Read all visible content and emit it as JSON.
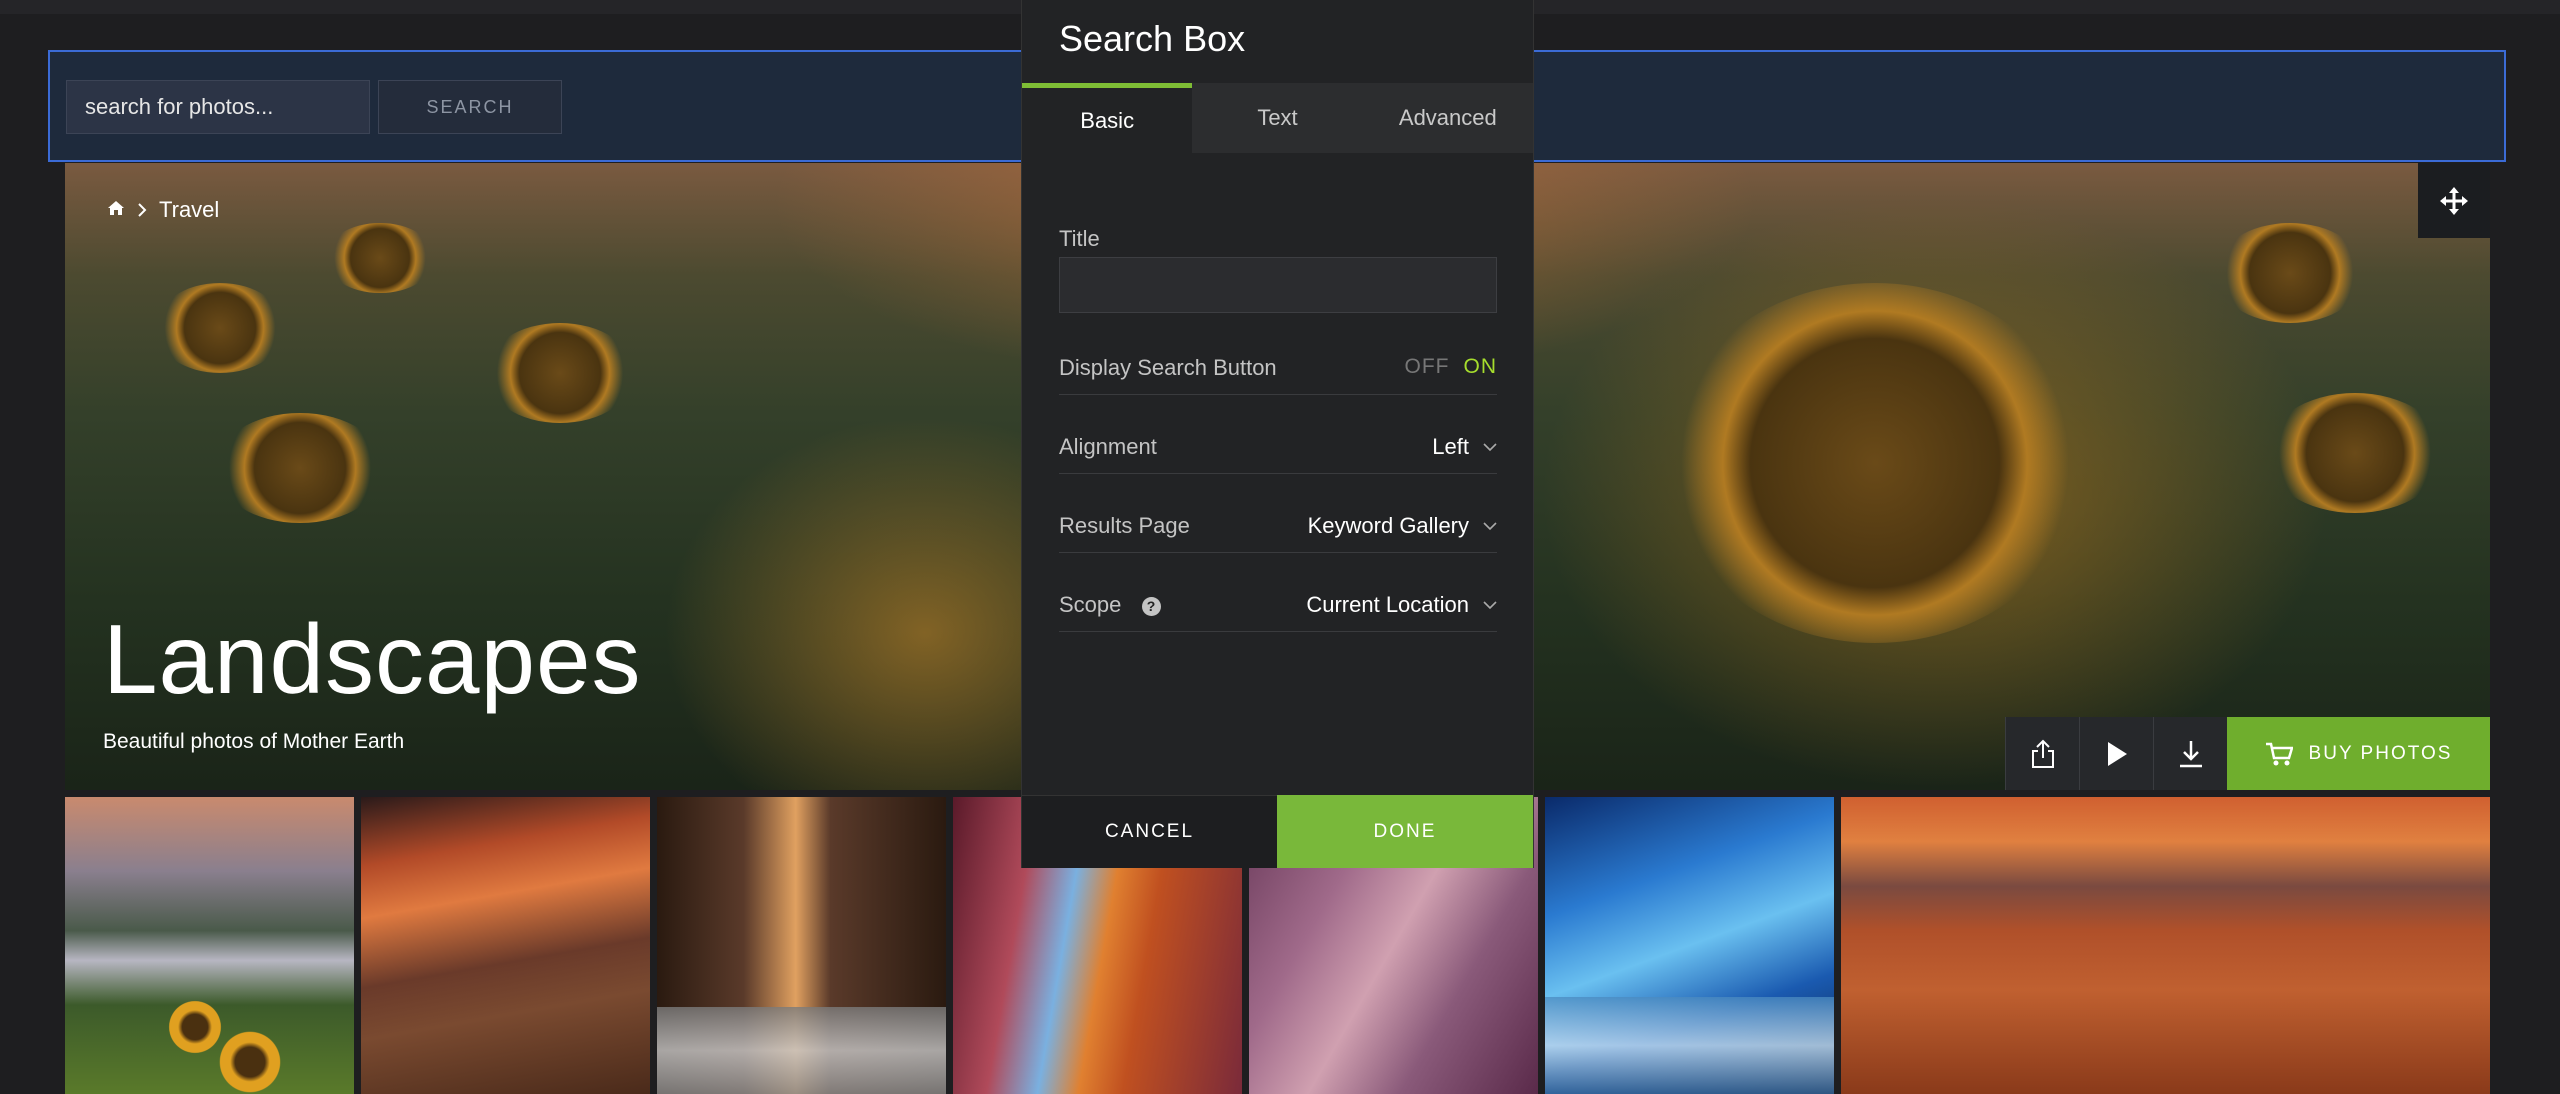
{
  "search": {
    "placeholder": "search for photos...",
    "button_label": "SEARCH"
  },
  "hero": {
    "breadcrumb": {
      "home_icon": "home-icon",
      "separator_icon": "chevron-right-icon",
      "current": "Travel"
    },
    "title": "Landscapes",
    "subtitle": "Beautiful photos of Mother Earth",
    "move_icon": "move-icon",
    "actions": [
      {
        "icon": "share-icon"
      },
      {
        "icon": "play-icon"
      },
      {
        "icon": "download-icon"
      }
    ],
    "buy_label": "BUY PHOTOS",
    "buy_icon": "cart-icon"
  },
  "dialog": {
    "title": "Search Box",
    "tabs": [
      {
        "label": "Basic",
        "active": true
      },
      {
        "label": "Text",
        "active": false
      },
      {
        "label": "Advanced",
        "active": false
      }
    ],
    "title_field_label": "Title",
    "title_field_value": "",
    "display_search_button": {
      "label": "Display Search Button",
      "off": "OFF",
      "on": "ON",
      "state": "ON"
    },
    "alignment": {
      "label": "Alignment",
      "value": "Left"
    },
    "results_page": {
      "label": "Results Page",
      "value": "Keyword Gallery"
    },
    "scope": {
      "label": "Scope",
      "value": "Current Location",
      "help_icon": "?"
    },
    "cancel_label": "CANCEL",
    "done_label": "DONE"
  },
  "colors": {
    "accent_green": "#79b83a",
    "toggle_on": "#a6dd2d",
    "selection_border": "#3b6bd6"
  }
}
